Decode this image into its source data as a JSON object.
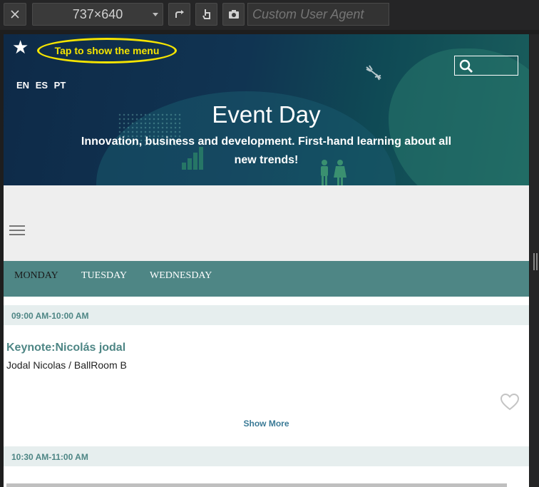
{
  "toolbar": {
    "dimensions": "737×640",
    "user_agent_placeholder": "Custom User Agent",
    "icons": [
      "close-icon",
      "rotate-icon",
      "touch-icon",
      "camera-icon"
    ]
  },
  "hero": {
    "menu_hint": "Tap to show the menu",
    "languages": [
      "EN",
      "ES",
      "PT"
    ],
    "title": "Event Day",
    "subtitle": "Innovation, business and development. First-hand learning about all new trends!"
  },
  "schedule": {
    "days": [
      "MONDAY",
      "TUESDAY",
      "WEDNESDAY"
    ],
    "active_day": "MONDAY",
    "slots": [
      {
        "time": "09:00 AM-10:00 AM",
        "session_title": "Keynote:Nicolás jodal",
        "session_meta": "Jodal Nicolas / BallRoom B",
        "show_more": "Show More"
      },
      {
        "time": "10:30 AM-11:00 AM"
      }
    ]
  },
  "colors": {
    "accent": "#4e8685",
    "hint": "#f5e400",
    "link": "#3a7a96"
  }
}
